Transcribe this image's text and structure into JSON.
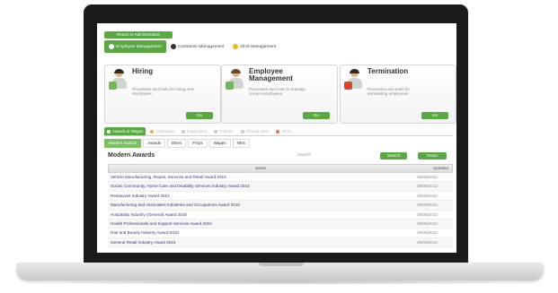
{
  "top": {
    "admin_button": "Return to Administration",
    "nav": [
      {
        "label": "Employee Management",
        "active": true
      },
      {
        "label": "Contractor Management",
        "active": false
      },
      {
        "label": "OHS Management",
        "active": false
      }
    ]
  },
  "cards": [
    {
      "title": "Hiring",
      "desc": "Processes and tools for hiring new employees",
      "go": "Go"
    },
    {
      "title": "Employee Management",
      "desc": "Processes and tools to manage current employees",
      "go": "Go"
    },
    {
      "title": "Termination",
      "desc": "Processes and tools for terminating employees",
      "go": "Go"
    }
  ],
  "tabs": [
    "Awards & Wages",
    "Calendars",
    "Employees",
    "Policies",
    "Shared Sites",
    "Alerts"
  ],
  "subtabs": [
    "Modern Awards",
    "Awards",
    "EBAs",
    "FAQs",
    "Wages",
    "NES"
  ],
  "section": {
    "title": "Modern Awards",
    "search_label": "Search",
    "search_button": "Search",
    "reset_button": "Reset"
  },
  "table": {
    "headers": {
      "name": "Name",
      "updated": "Updated"
    },
    "rows": [
      {
        "name": "Vehicle Manufacturing, Repair, Services and Retail Award 2010",
        "updated": "29/06/2012"
      },
      {
        "name": "Social, Community, Home Care and Disability Services Industry Award 2010",
        "updated": "29/06/2012"
      },
      {
        "name": "Restaurant Industry Award 2010",
        "updated": "29/06/2012"
      },
      {
        "name": "Manufacturing and Associated Industries and Occupations Award 2010",
        "updated": "29/06/2012"
      },
      {
        "name": "Hospitality Industry (General) Award 2010",
        "updated": "29/06/2012"
      },
      {
        "name": "Health Professionals and Support Services Award 2010",
        "updated": "29/06/2012"
      },
      {
        "name": "Hair and Beauty Industry Award 2010",
        "updated": "29/06/2012"
      },
      {
        "name": "General Retail Industry Award 2010",
        "updated": "29/06/2012"
      }
    ]
  },
  "colors": {
    "accent": "#5aa844",
    "link": "#2b3a7a"
  }
}
